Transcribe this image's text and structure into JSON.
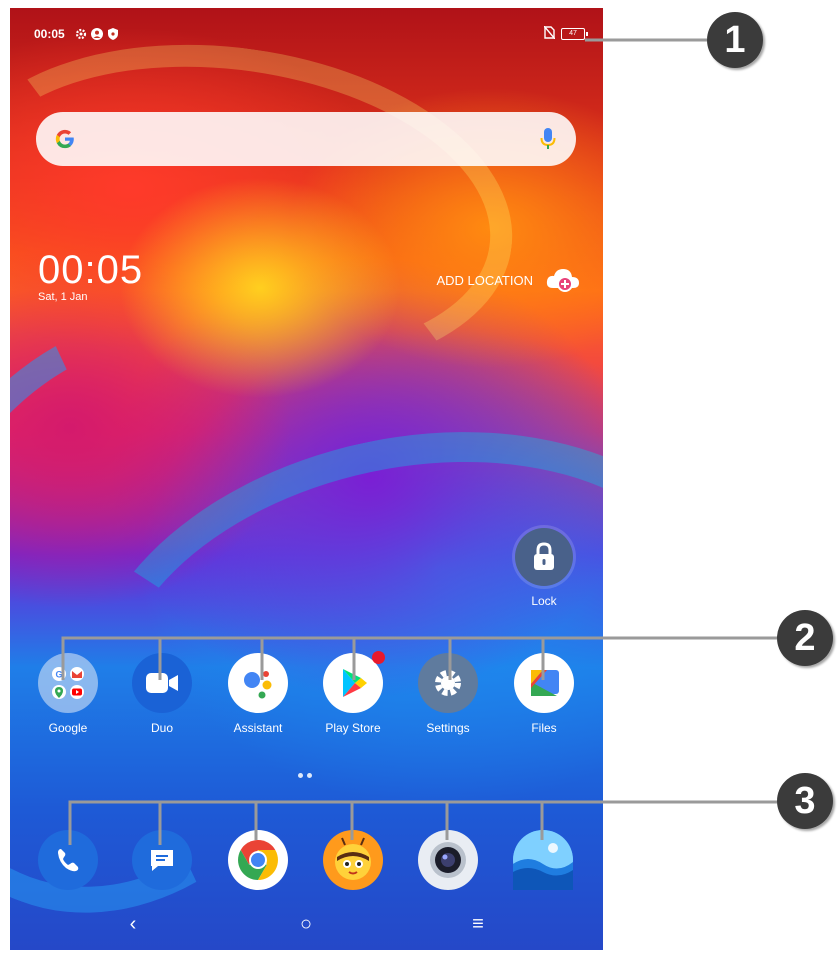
{
  "status_bar": {
    "time": "00:05",
    "left_icons": [
      "settings-icon",
      "account-icon",
      "shield-icon"
    ],
    "right_icons": [
      "no-sim-icon",
      "battery-icon"
    ],
    "battery_label": "47"
  },
  "search_bar": {
    "logo": "google-g-icon",
    "mic": "mic-icon"
  },
  "clock_widget": {
    "time": "00:05",
    "date": "Sat, 1 Jan"
  },
  "weather_widget": {
    "label": "ADD LOCATION",
    "icon": "cloud-add-icon"
  },
  "lock_shortcut": {
    "label": "Lock",
    "icon": "lock-icon"
  },
  "apps": [
    {
      "label": "Google",
      "icon": "google-folder-icon"
    },
    {
      "label": "Duo",
      "icon": "duo-camera-icon"
    },
    {
      "label": "Assistant",
      "icon": "assistant-icon"
    },
    {
      "label": "Play Store",
      "icon": "play-store-icon",
      "badge": true
    },
    {
      "label": "Settings",
      "icon": "settings-gear-icon"
    },
    {
      "label": "Files",
      "icon": "files-icon"
    }
  ],
  "dock": [
    {
      "icon": "phone-icon"
    },
    {
      "icon": "messages-icon"
    },
    {
      "icon": "chrome-icon"
    },
    {
      "icon": "bee-app-icon"
    },
    {
      "icon": "camera-icon"
    },
    {
      "icon": "gallery-icon"
    }
  ],
  "nav_bar": {
    "back": "‹",
    "home": "○",
    "recents": "≡"
  },
  "callouts": {
    "one": "1",
    "two": "2",
    "three": "3"
  },
  "colors": {
    "callout": "#3b3b3b",
    "leader_line": "#9a9a9a"
  }
}
